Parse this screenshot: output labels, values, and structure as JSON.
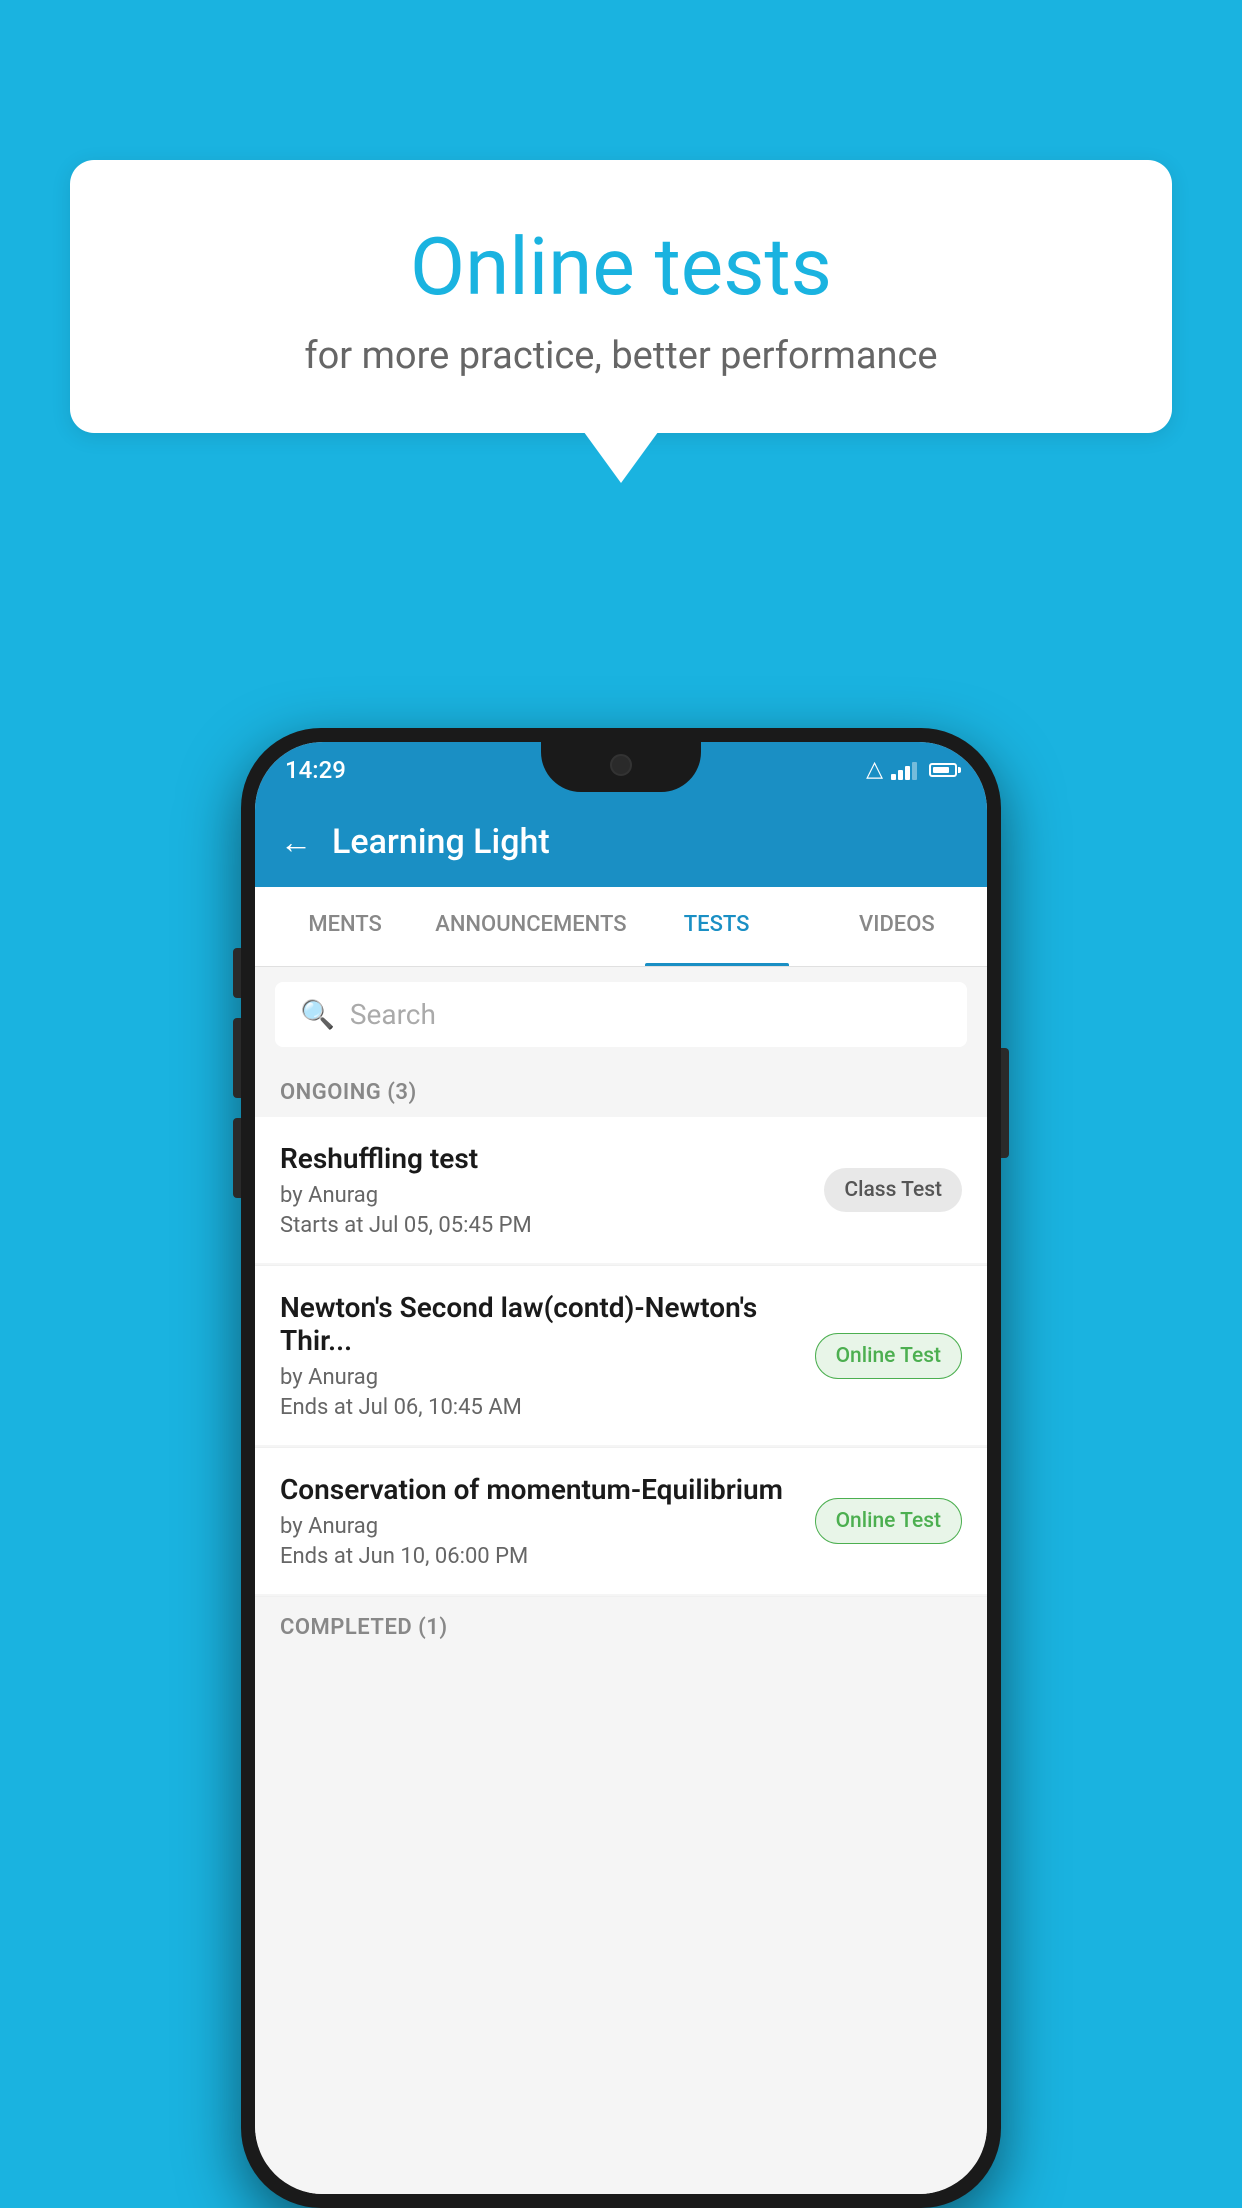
{
  "bubble": {
    "title": "Online tests",
    "subtitle": "for more practice, better performance"
  },
  "phone": {
    "status_bar": {
      "time": "14:29"
    },
    "header": {
      "title": "Learning Light"
    },
    "tabs": [
      {
        "label": "MENTS",
        "active": false
      },
      {
        "label": "ANNOUNCEMENTS",
        "active": false
      },
      {
        "label": "TESTS",
        "active": true
      },
      {
        "label": "VIDEOS",
        "active": false
      }
    ],
    "search": {
      "placeholder": "Search"
    },
    "ongoing_section": {
      "header": "ONGOING (3)"
    },
    "tests": [
      {
        "title": "Reshuffling test",
        "by": "by Anurag",
        "date": "Starts at  Jul 05, 05:45 PM",
        "badge": "Class Test",
        "badge_type": "class"
      },
      {
        "title": "Newton's Second law(contd)-Newton's Thir...",
        "by": "by Anurag",
        "date": "Ends at  Jul 06, 10:45 AM",
        "badge": "Online Test",
        "badge_type": "online"
      },
      {
        "title": "Conservation of momentum-Equilibrium",
        "by": "by Anurag",
        "date": "Ends at  Jun 10, 06:00 PM",
        "badge": "Online Test",
        "badge_type": "online"
      }
    ],
    "completed_section": {
      "header": "COMPLETED (1)"
    }
  },
  "colors": {
    "bg": "#1ab3e0",
    "header_blue": "#1a8fc4",
    "white": "#ffffff",
    "text_dark": "#1a1a1a",
    "text_gray": "#666666",
    "badge_class_bg": "#e8e8e8",
    "badge_class_text": "#555555",
    "badge_online_bg": "#e8f5e8",
    "badge_online_text": "#4caf50"
  }
}
